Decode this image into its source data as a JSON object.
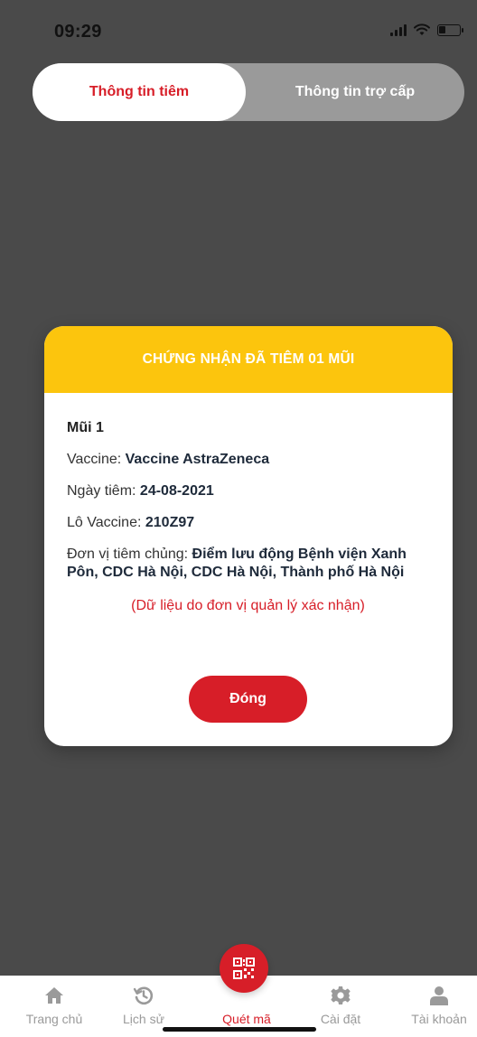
{
  "status_bar": {
    "time": "09:29"
  },
  "tabs": {
    "active": "Thông tin tiêm",
    "inactive": "Thông tin trợ cấp"
  },
  "modal": {
    "title": "CHỨNG NHẬN ĐÃ TIÊM 01 MŨI",
    "dose_title": "Mũi 1",
    "vaccine_label": "Vaccine: ",
    "vaccine_value": "Vaccine AstraZeneca",
    "date_label": "Ngày tiêm: ",
    "date_value": "24-08-2021",
    "lot_label": "Lô Vaccine: ",
    "lot_value": "210Z97",
    "unit_label": "Đơn vị tiêm chủng: ",
    "unit_value": "Điểm lưu động Bệnh viện Xanh Pôn, CDC Hà Nội, CDC Hà Nội, Thành phố Hà Nội",
    "note": "(Dữ liệu do đơn vị quản lý xác nhận)",
    "close_label": "Đóng"
  },
  "bottom_nav": {
    "items": [
      {
        "label": "Trang chủ",
        "icon": "home-icon"
      },
      {
        "label": "Lịch sử",
        "icon": "history-icon"
      },
      {
        "label": "Quét mã",
        "icon": "qr-code-icon"
      },
      {
        "label": "Cài đặt",
        "icon": "gear-icon"
      },
      {
        "label": "Tài khoản",
        "icon": "user-icon"
      }
    ],
    "active_index": 2
  },
  "colors": {
    "accent_red": "#d71e28",
    "header_yellow": "#fcc50d",
    "overlay": "#4a4a4a"
  }
}
